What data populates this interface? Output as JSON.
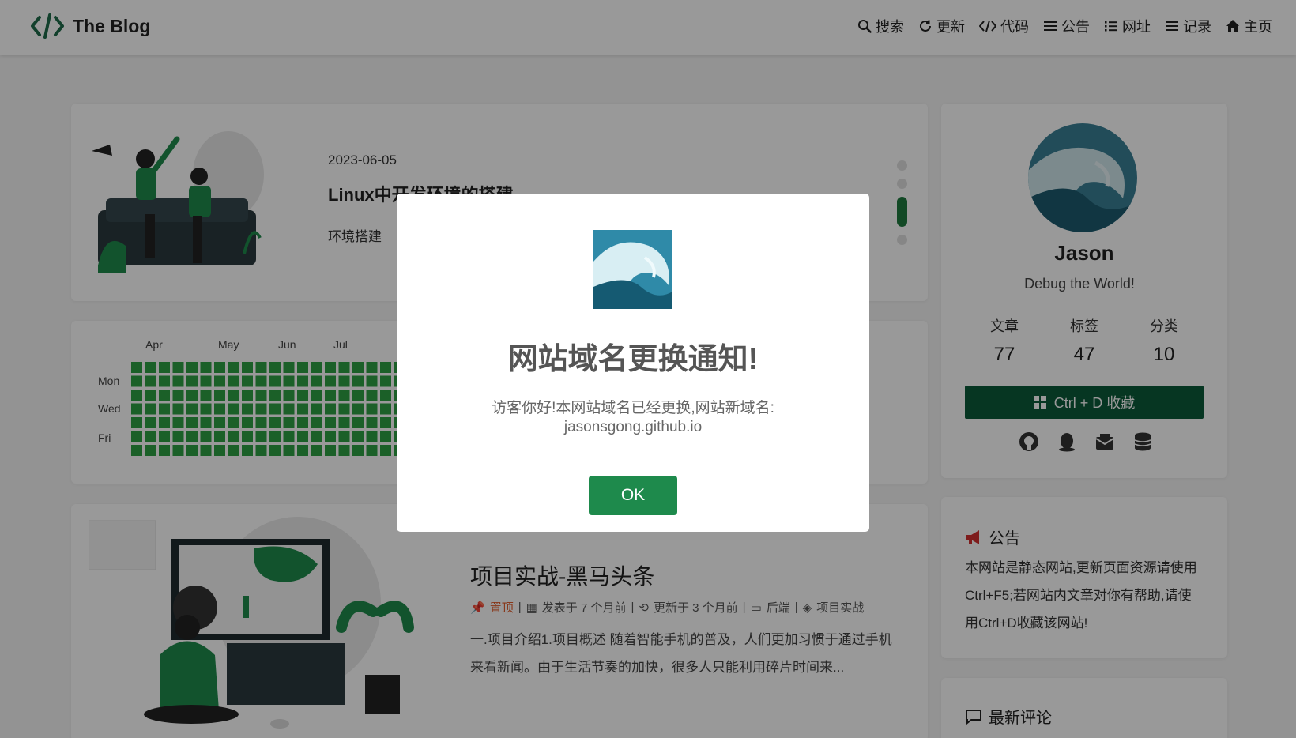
{
  "header": {
    "logo_text": "The Blog",
    "nav": [
      {
        "label": "搜索",
        "icon": "search-icon"
      },
      {
        "label": "更新",
        "icon": "refresh-icon"
      },
      {
        "label": "代码",
        "icon": "code-icon"
      },
      {
        "label": "公告",
        "icon": "list-icon"
      },
      {
        "label": "网址",
        "icon": "list-ul-icon"
      },
      {
        "label": "记录",
        "icon": "list-icon"
      },
      {
        "label": "主页",
        "icon": "home-icon"
      }
    ]
  },
  "post1": {
    "date": "2023-06-05",
    "title": "Linux中开发环境的搭建",
    "tag": "环境搭建"
  },
  "heatmap": {
    "months": [
      "Apr",
      "May",
      "Jun",
      "Jul"
    ],
    "days": [
      "Mon",
      "Wed",
      "Fri"
    ],
    "color": "#2ea043"
  },
  "post2": {
    "title": "项目实战-黑马头条",
    "meta": {
      "pinned": "置顶",
      "published": "发表于 7 个月前",
      "updated": "更新于 3 个月前",
      "category": "后端",
      "tag": "项目实战"
    },
    "excerpt": "一.项目介绍1.项目概述 随着智能手机的普及，人们更加习惯于通过手机来看新闻。由于生活节奏的加快，很多人只能利用碎片时间来..."
  },
  "profile": {
    "name": "Jason",
    "motto": "Debug the World!",
    "stats": [
      {
        "label": "文章",
        "value": "77"
      },
      {
        "label": "标签",
        "value": "47"
      },
      {
        "label": "分类",
        "value": "10"
      }
    ],
    "fav_button": "Ctrl + D 收藏"
  },
  "notice": {
    "title": "公告",
    "body": "本网站是静态网站,更新页面资源请使用Ctrl+F5;若网站内文章对你有帮助,请使用Ctrl+D收藏该网站!"
  },
  "comments": {
    "title": "最新评论"
  },
  "modal": {
    "title": "网站域名更换通知!",
    "text_line1": "访客你好!本网站域名已经更换,网站新域名:",
    "text_line2": "jasonsgong.github.io",
    "ok": "OK"
  },
  "colors": {
    "accent": "#1e8a4c",
    "fav_button": "#0a5a3a",
    "pin": "#e35d2a",
    "heat": "#2ea043"
  }
}
